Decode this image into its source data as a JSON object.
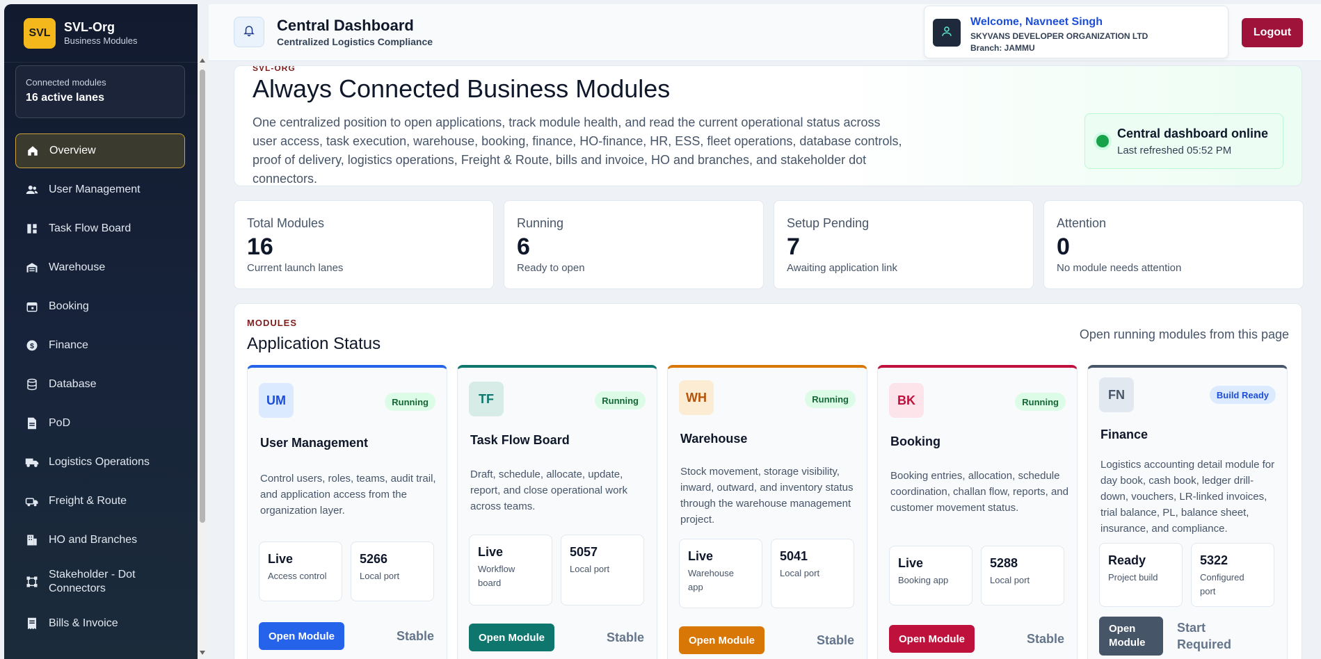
{
  "brand": {
    "logo": "SVL",
    "name": "SVL-Org",
    "subtitle": "Business Modules"
  },
  "sidebar": {
    "connected_label": "Connected modules",
    "connected_value": "16 active lanes",
    "items": [
      {
        "label": "Overview",
        "icon": "home-icon"
      },
      {
        "label": "User Management",
        "icon": "users-icon"
      },
      {
        "label": "Task Flow Board",
        "icon": "board-icon"
      },
      {
        "label": "Warehouse",
        "icon": "warehouse-icon"
      },
      {
        "label": "Booking",
        "icon": "calendar-icon"
      },
      {
        "label": "Finance",
        "icon": "dollar-icon"
      },
      {
        "label": "Database",
        "icon": "database-icon"
      },
      {
        "label": "PoD",
        "icon": "document-icon"
      },
      {
        "label": "Logistics Operations",
        "icon": "truck-icon"
      },
      {
        "label": "Freight & Route",
        "icon": "route-icon"
      },
      {
        "label": "HO and Branches",
        "icon": "building-icon"
      },
      {
        "label": "Stakeholder - Dot Connectors",
        "icon": "connectors-icon"
      },
      {
        "label": "Bills & Invoice",
        "icon": "receipt-icon"
      }
    ]
  },
  "header": {
    "title": "Central Dashboard",
    "subtitle": "Centralized Logistics Compliance",
    "welcome": "Welcome, Navneet Singh",
    "org": "SKYVANS DEVELOPER ORGANIZATION LTD",
    "branch": "Branch: JAMMU",
    "logout": "Logout"
  },
  "hero": {
    "tag": "SVL-ORG",
    "title": "Always Connected Business Modules",
    "description": "One centralized position to open applications, track module health, and read the current operational status across user access, task execution, warehouse, booking, finance, HO-finance, HR, ESS, fleet operations, database controls, proof of delivery, logistics operations, Freight & Route, bills and invoice, HO and branches, and stakeholder dot connectors.",
    "online_title": "Central dashboard online",
    "online_sub": "Last refreshed 05:52 PM"
  },
  "stats": [
    {
      "label": "Total Modules",
      "value": "16",
      "sub": "Current launch lanes"
    },
    {
      "label": "Running",
      "value": "6",
      "sub": "Ready to open"
    },
    {
      "label": "Setup Pending",
      "value": "7",
      "sub": "Awaiting application link"
    },
    {
      "label": "Attention",
      "value": "0",
      "sub": "No module needs attention"
    }
  ],
  "modules": {
    "tag": "MODULES",
    "title": "Application Status",
    "right_text": "Open running modules from this page",
    "cards": [
      {
        "code": "UM",
        "status": "Running",
        "title": "User Management",
        "desc": "Control users, roles, teams, audit trail, and application access from the organization layer.",
        "m1_value": "Live",
        "m1_label": "Access control",
        "m2_value": "5266",
        "m2_label": "Local port",
        "button": "Open Module",
        "footer": "Stable"
      },
      {
        "code": "TF",
        "status": "Running",
        "title": "Task Flow Board",
        "desc": "Draft, schedule, allocate, update, report, and close operational work across teams.",
        "m1_value": "Live",
        "m1_label": "Workflow board",
        "m2_value": "5057",
        "m2_label": "Local port",
        "button": "Open Module",
        "footer": "Stable"
      },
      {
        "code": "WH",
        "status": "Running",
        "title": "Warehouse",
        "desc": "Stock movement, storage visibility, inward, outward, and inventory status through the warehouse management project.",
        "m1_value": "Live",
        "m1_label": "Warehouse app",
        "m2_value": "5041",
        "m2_label": "Local port",
        "button": "Open Module",
        "footer": "Stable"
      },
      {
        "code": "BK",
        "status": "Running",
        "title": "Booking",
        "desc": "Booking entries, allocation, schedule coordination, challan flow, reports, and customer movement status.",
        "m1_value": "Live",
        "m1_label": "Booking app",
        "m2_value": "5288",
        "m2_label": "Local port",
        "button": "Open Module",
        "footer": "Stable"
      },
      {
        "code": "FN",
        "status": "Build Ready",
        "title": "Finance",
        "desc": "Logistics accounting detail module for day book, cash book, ledger drill-down, vouchers, LR-linked invoices, trial balance, PL, balance sheet, insurance, and compliance.",
        "m1_value": "Ready",
        "m1_label": "Project build",
        "m2_value": "5322",
        "m2_label": "Configured port",
        "button": "Open Module",
        "footer": "Start Required"
      }
    ]
  },
  "colors": {
    "um": "#2563eb",
    "tf": "#0f766e",
    "wh": "#d97706",
    "bk": "#be123c",
    "fn": "#475569",
    "logout": "#9f1239",
    "gold": "#f4b81c"
  }
}
